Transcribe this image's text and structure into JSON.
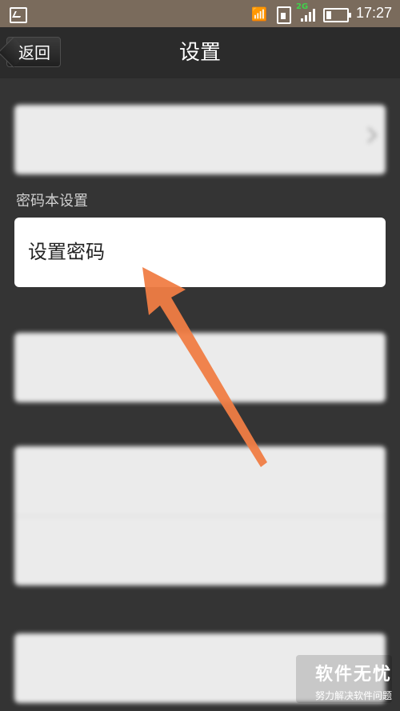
{
  "status_bar": {
    "time": "17:27",
    "network_type": "2G",
    "icons": [
      "image-icon",
      "wifi-icon",
      "sim-card-icon",
      "signal-icon",
      "battery-icon"
    ]
  },
  "header": {
    "back_label": "返回",
    "title": "设置"
  },
  "sections": [
    {
      "label": "",
      "items": [
        {
          "label": "",
          "value": ""
        }
      ]
    },
    {
      "label": "密码本设置",
      "items": [
        {
          "label": "设置密码"
        }
      ]
    },
    {
      "label": "",
      "items": [
        {
          "label": ""
        }
      ]
    },
    {
      "label": "",
      "items": [
        {
          "label": ""
        },
        {
          "label": ""
        }
      ]
    },
    {
      "label": "",
      "items": [
        {
          "label": ""
        }
      ]
    }
  ],
  "overlay": {
    "arrow_color": "#f07d44"
  },
  "watermark": {
    "title": "软件无忧",
    "subtitle": "努力解决软件问题"
  },
  "colors": {
    "status_bar": "#7a6b5c",
    "header_bg": "#2b2b2b",
    "content_bg": "#343434",
    "card_bg": "#ffffff"
  }
}
